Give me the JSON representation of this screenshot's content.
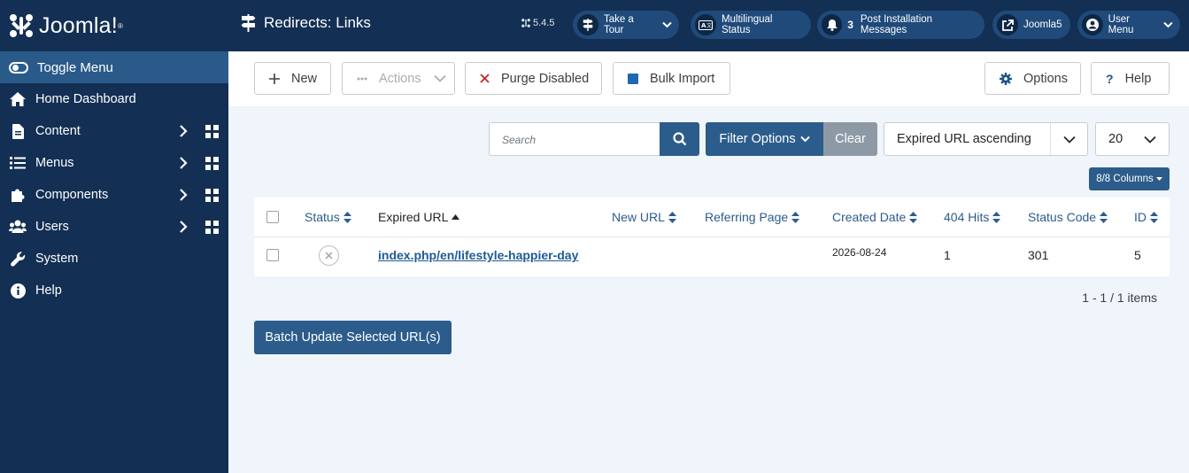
{
  "sidebar": {
    "logo": "Joomla!",
    "toggle": "Toggle Menu",
    "items": [
      {
        "label": "Home Dashboard"
      },
      {
        "label": "Content"
      },
      {
        "label": "Menus"
      },
      {
        "label": "Components"
      },
      {
        "label": "Users"
      },
      {
        "label": "System"
      },
      {
        "label": "Help"
      }
    ]
  },
  "header": {
    "title": "Redirects: Links",
    "version": "5.4.5",
    "tour": "Take a Tour",
    "multilingual": "Multilingual Status",
    "post_count": "3",
    "post_install": "Post Installation Messages",
    "site": "Joomla5",
    "user_menu": "User Menu"
  },
  "toolbar": {
    "new": "New",
    "actions": "Actions",
    "purge": "Purge Disabled",
    "bulk": "Bulk Import",
    "options": "Options",
    "help": "Help"
  },
  "filters": {
    "search_placeholder": "Search",
    "filter_options": "Filter Options",
    "clear": "Clear",
    "ordering": "Expired URL ascending",
    "limit": "20",
    "columns": "8/8 Columns"
  },
  "table": {
    "headers": {
      "status": "Status",
      "expired_url": "Expired URL",
      "new_url": "New URL",
      "referring_page": "Referring Page",
      "created_date": "Created Date",
      "hits": "404 Hits",
      "status_code": "Status Code",
      "id": "ID"
    },
    "rows": [
      {
        "expired_url": "index.php/en/lifestyle-happier-day",
        "new_url": "",
        "referring_page": "",
        "created_date": "2026-08-24",
        "hits": "1",
        "status_code": "301",
        "id": "5"
      }
    ]
  },
  "pagination": {
    "items": "1 - 1 / 1 items"
  },
  "batch": "Batch Update Selected URL(s)"
}
